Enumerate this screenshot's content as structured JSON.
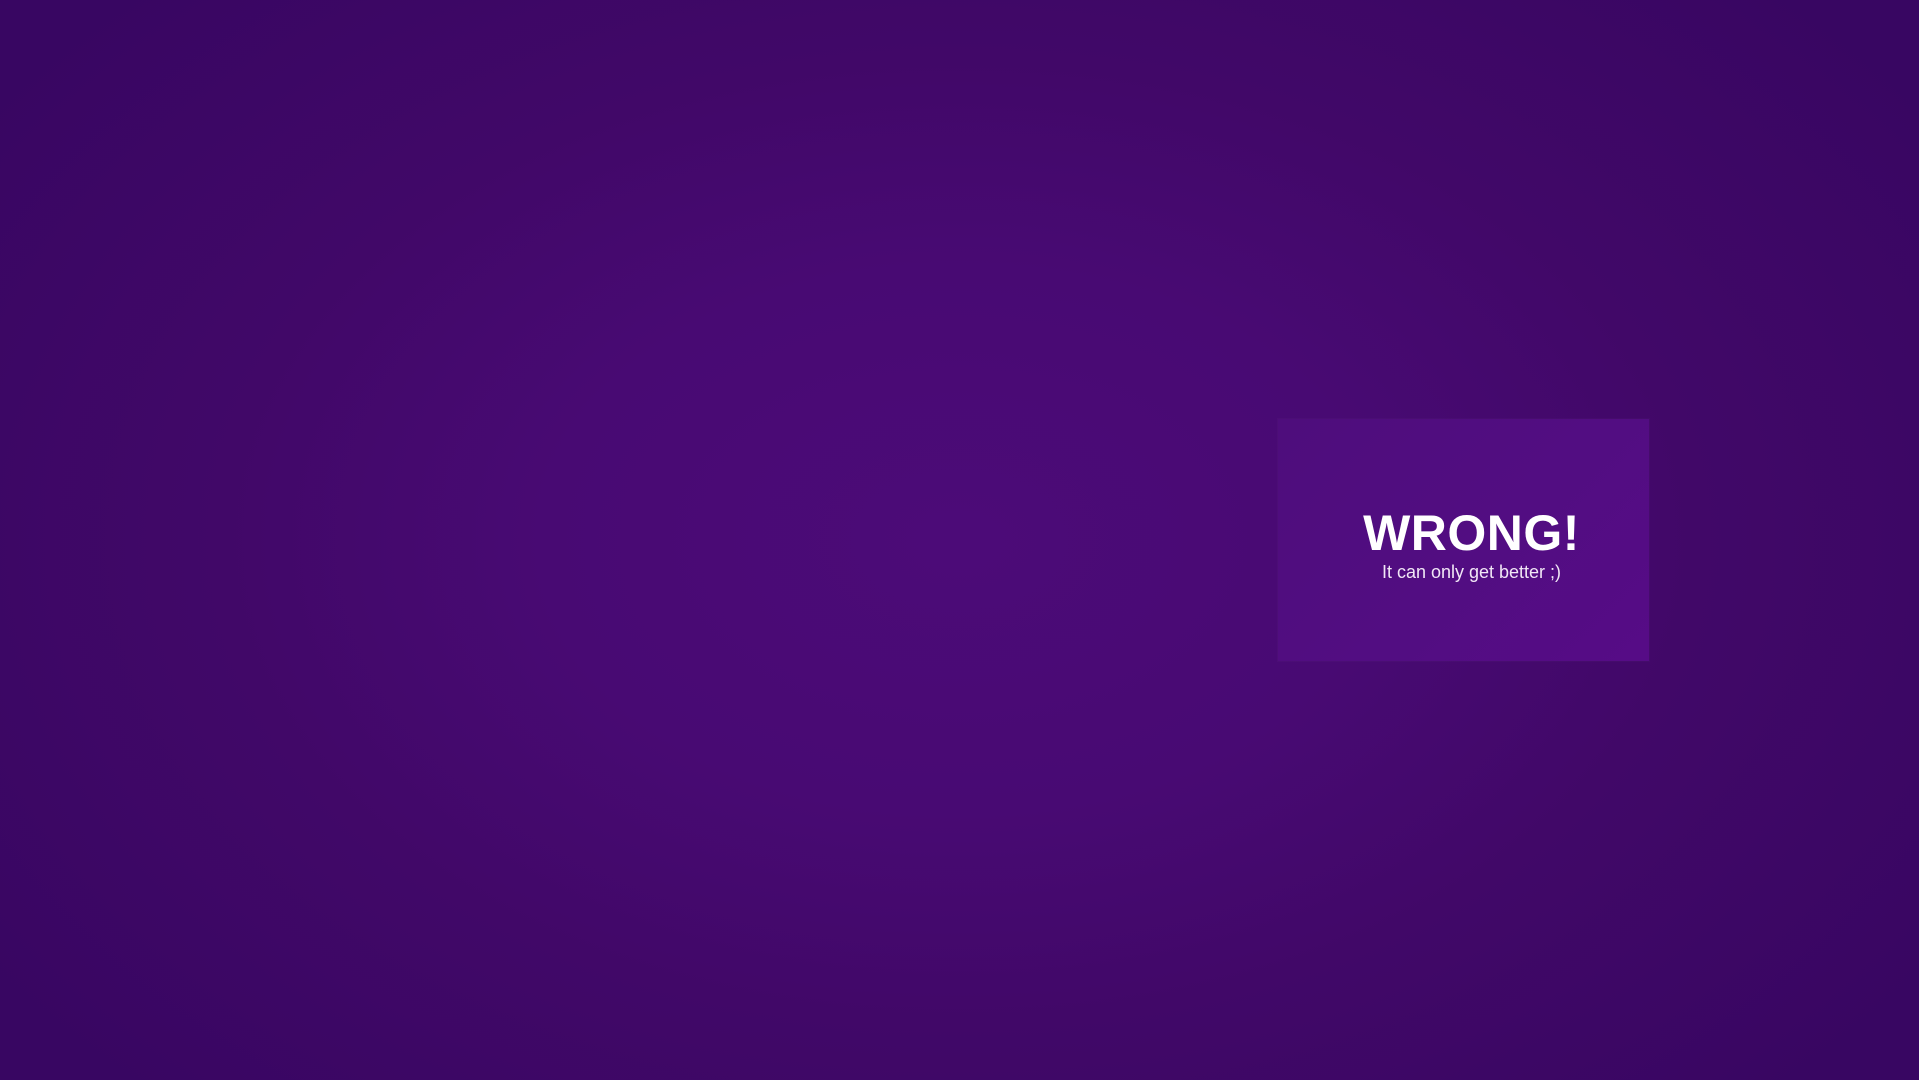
{
  "colors": {
    "background_center": "#4c0b78",
    "background_edge": "#380662",
    "card": "#520d82",
    "text": "#ffffff"
  },
  "feedback": {
    "title": "WRONG!",
    "subtitle": "It can only get better ;)"
  }
}
